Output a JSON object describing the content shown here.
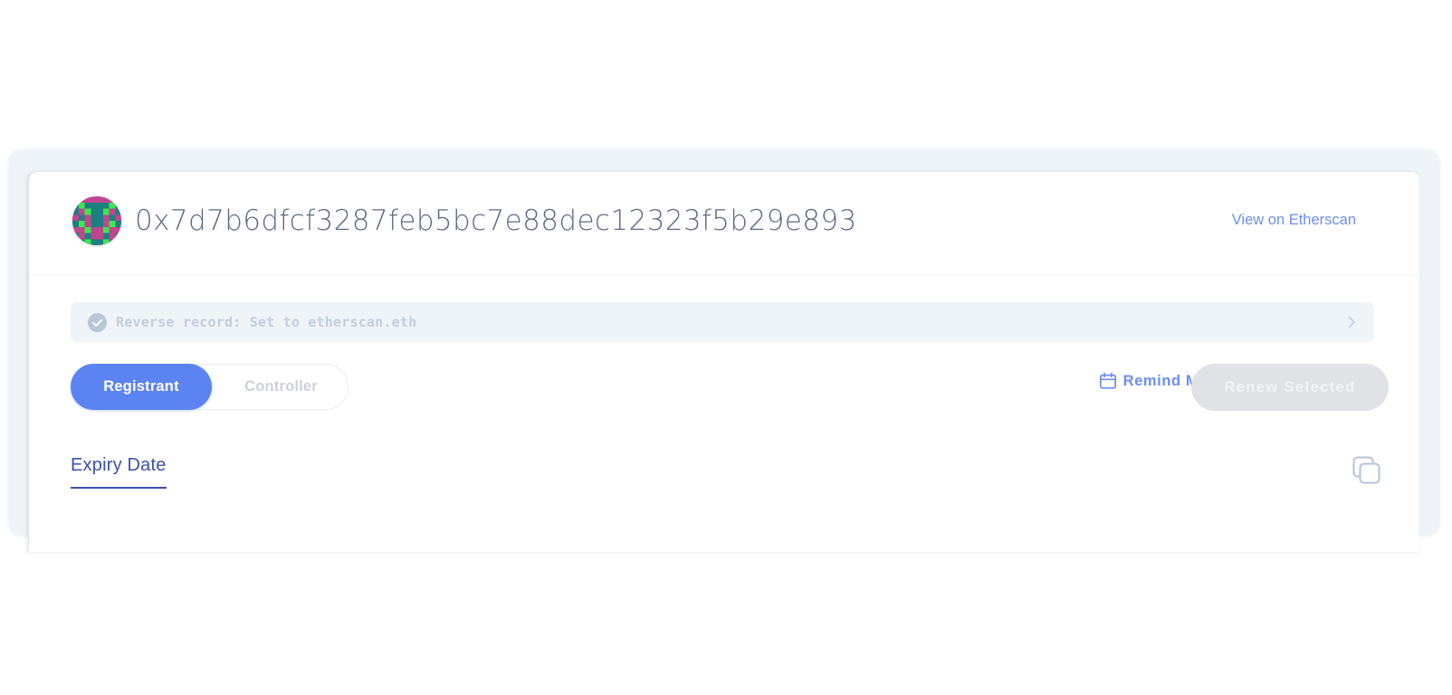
{
  "header": {
    "address": "0x7d7b6dfcf3287feb5bc7e88dec12323f5b29e893",
    "etherscan_link": "View on Etherscan",
    "avatar_icon": "blockie-avatar"
  },
  "reverse_record": {
    "text": "Reverse record: Set to etherscan.eth",
    "check_icon": "check-circle-icon",
    "chevron_icon": "chevron-right-icon"
  },
  "toggle": {
    "options": [
      {
        "label": "Registrant",
        "active": true
      },
      {
        "label": "Controller",
        "active": false
      }
    ]
  },
  "actions": {
    "remind_me": "Remind Me",
    "remind_icon": "calendar-icon",
    "renew_selected": "Renew Selected"
  },
  "table": {
    "columns": [
      {
        "label": "Expiry Date",
        "sorted": true
      }
    ],
    "copy_icon": "copy-icon"
  },
  "colors": {
    "accent_blue": "#5c83f2",
    "link_blue": "#6c8df5",
    "header_blue": "#3b4fae",
    "panel_bg": "#eef4f8",
    "muted": "#c2cede",
    "disabled_bg": "#e0e2e5"
  }
}
